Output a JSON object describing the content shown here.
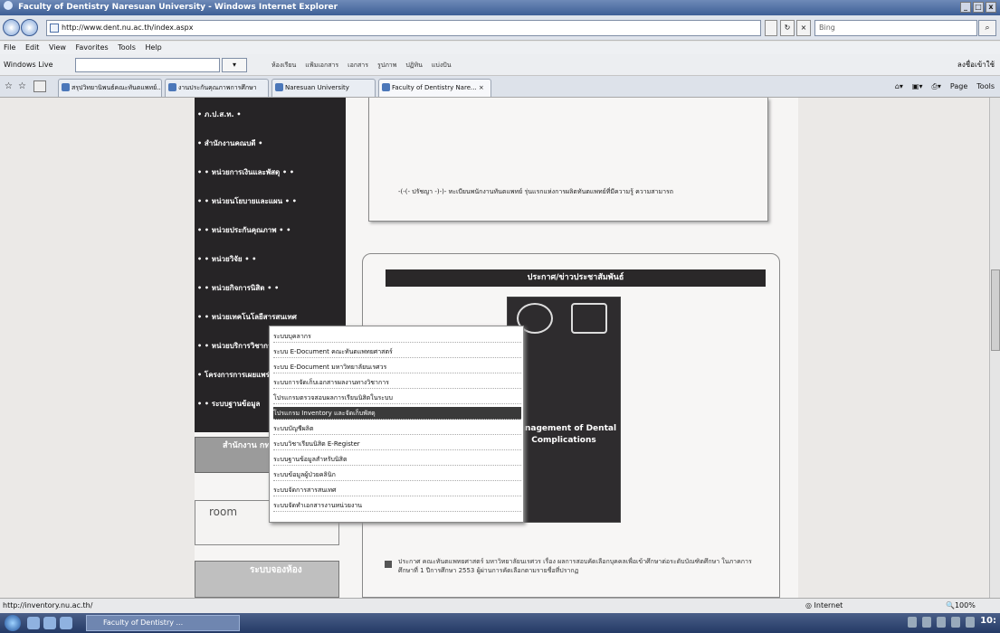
{
  "window": {
    "title": "Faculty of Dentistry Naresuan University - Windows Internet Explorer"
  },
  "address": {
    "url": "http://www.dent.nu.ac.th/index.aspx",
    "search_placeholder": "Bing"
  },
  "menubar": [
    "File",
    "Edit",
    "View",
    "Favorites",
    "Tools",
    "Help"
  ],
  "live": {
    "label": "Windows Live",
    "links": [
      "ห้องเรียน",
      "แฟ้มเอกสาร",
      "เอกสาร",
      "รูปภาพ",
      "ปฏิทิน",
      "แบ่งปัน"
    ],
    "right": "ลงชื่อเข้าใช้"
  },
  "tabs": [
    "สรุปวิทยานิพนธ์คณะทันตแพทย์...",
    "งานประกันคุณภาพการศึกษา",
    "Naresuan University",
    "Faculty of Dentistry Nare..."
  ],
  "commandbar": [
    "Page",
    "Tools"
  ],
  "leftnav": [
    "• ภ.ป.ส.ท. •",
    "• สำนักงานคณบดี •",
    "• • หน่วยการเงินและพัสดุ • •",
    "• • หน่วยนโยบายและแผน • •",
    "• • หน่วยประกันคุณภาพ • •",
    "• • หน่วยวิจัย • •",
    "• • หน่วยกิจการนิสิต • •",
    "• • หน่วยเทคโนโลยีสารสนเทศ",
    "• • หน่วยบริการวิชาการ",
    "• โครงการการเผยแพร่ความรู้",
    "• • ระบบฐานข้อมูล"
  ],
  "banners": {
    "b1": "สำนักงาน กท.",
    "b2": "room",
    "b3": "ระบบจองห้อง"
  },
  "marquee": "-(-(- ปรัชญา -)-)- ทะเบียนพนักงานทันตแพทย์ รุ่นแรกแห่งการผลิตทันตแพทย์ที่มีความรู้ ความสามารถ",
  "news_header": "ประกาศ/ข่าวประชาสัมพันธ์",
  "poster_title": "Management of Dental Complications",
  "body_text": "ประกาศ คณะทันตแพทยศาสตร์ มหาวิทยาลัยนเรศวร เรื่อง ผลการสอบคัดเลือกบุคคลเพื่อเข้าศึกษาต่อระดับบัณฑิตศึกษา ในภาคการศึกษาที่ 1 ปีการศึกษา 2553 ผู้ผ่านการคัดเลือกตามรายชื่อที่ปรากฏ",
  "dropdown": [
    "ระบบบุคลากร",
    "ระบบ E-Document คณะทันตแพทยศาสตร์",
    "ระบบ E-Document มหาวิทยาลัยนเรศวร",
    "ระบบการจัดเก็บเอกสารผลงานทางวิชาการ",
    "โปรแกรมตรวจสอบผลการเรียนนิสิตในระบบ",
    "โปรแกรม Inventory และจัดเก็บพัสดุ",
    "ระบบบัญชีผลิต",
    "ระบบวิชาเรียนนิสิต E-Register",
    "ระบบฐานข้อมูลสำหรับนิสิต",
    "ระบบข้อมูลผู้ป่วยคลินิก",
    "ระบบจัดการสารสนเทศ",
    "ระบบจัดทำเอกสารงานหน่วยงาน"
  ],
  "status": {
    "url": "http://inventory.nu.ac.th/",
    "zone": "Internet",
    "zoom": "100%"
  },
  "taskbar": {
    "button": "Faculty of Dentistry ...",
    "clock": "10:"
  }
}
